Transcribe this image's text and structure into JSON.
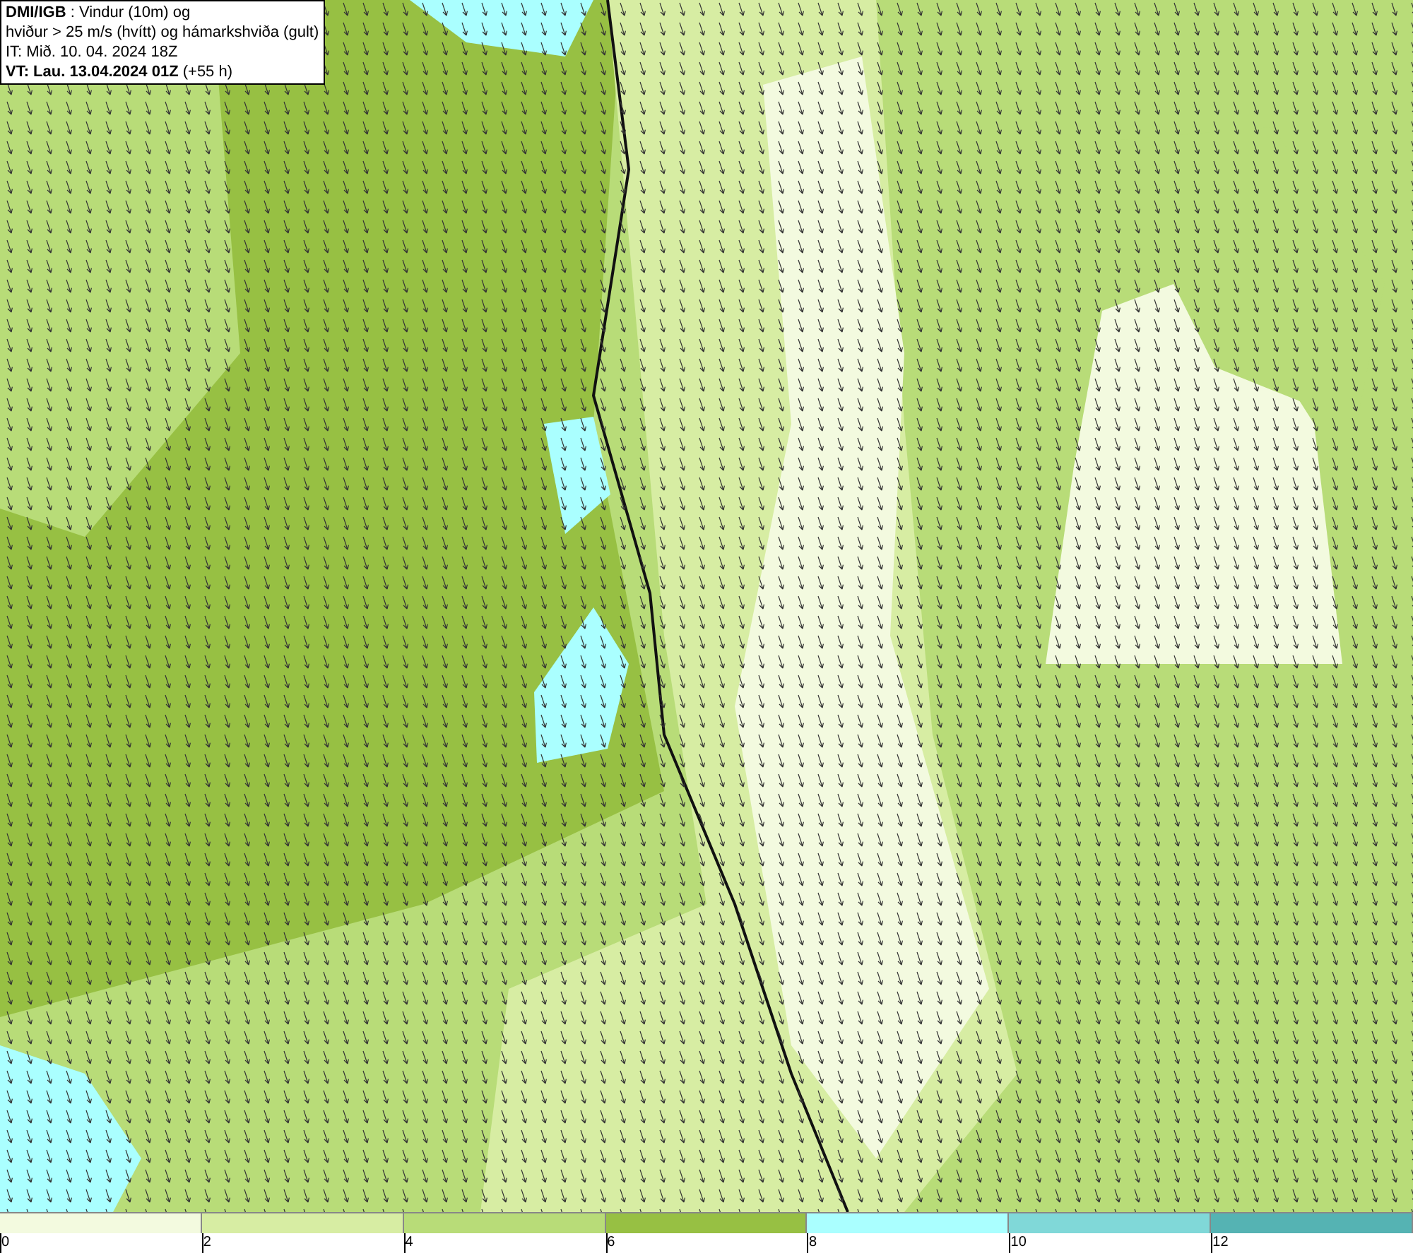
{
  "legend": {
    "lines": [
      "**DMI/IGB** : Vindur (10m) og",
      "hviður > 25 m/s (hvítt) og hámarkshviða (gult)",
      "IT: Mið. 10. 04. 2024 18Z",
      "**VT: Lau. 13.04.2024 01Z** (+55 h)"
    ]
  },
  "colorbar": {
    "segments": [
      {
        "color": "#f3fadf"
      },
      {
        "color": "#d7eda3"
      },
      {
        "color": "#b8dc78"
      },
      {
        "color": "#97c043"
      },
      {
        "color": "#aaffff"
      },
      {
        "color": "#80d8d8"
      },
      {
        "color": "#55b3b3"
      }
    ],
    "ticks": [
      "0",
      "2",
      "4",
      "6",
      "8",
      "10",
      "12"
    ]
  }
}
